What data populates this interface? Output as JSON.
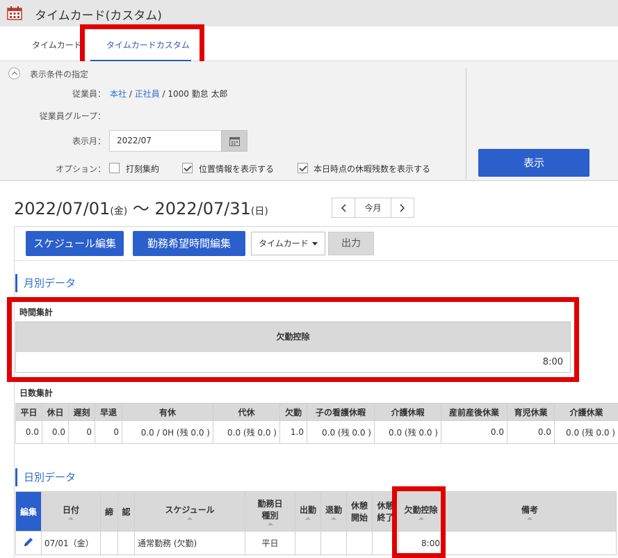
{
  "window": {
    "title": "タイムカード(カスタム)",
    "icon": "calendar-icon"
  },
  "tabs": [
    {
      "label": "タイムカード",
      "active": false
    },
    {
      "label": "タイムカードカスタム",
      "active": true
    }
  ],
  "conditions": {
    "title": "表示条件の指定",
    "employee_label": "従業員：",
    "employee": {
      "company": "本社",
      "sep1": " / ",
      "type": "正社員",
      "rest": " / 1000 勤怠 太郎"
    },
    "group_label": "従業員グループ：",
    "month_label": "表示月：",
    "month_value": "2022/07",
    "options_label": "オプション：",
    "options": [
      {
        "label": "打刻集約",
        "checked": false
      },
      {
        "label": "位置情報を表示する",
        "checked": true
      },
      {
        "label": "本日時点の休暇残数を表示する",
        "checked": true
      }
    ],
    "show_button": "表示"
  },
  "range": {
    "start": "2022/07/01",
    "start_day": "(金)",
    "sep": " 〜 ",
    "end": "2022/07/31",
    "end_day": "(日)"
  },
  "nav": {
    "today": "今月"
  },
  "toolbar": {
    "schedule_edit": "スケジュール編集",
    "wish_edit": "勤務希望時間編集",
    "select_value": "タイムカード",
    "output": "出力"
  },
  "monthly": {
    "section_title": "月別データ",
    "time_summary_title": "時間集計",
    "time_header": "欠勤控除",
    "time_value": "8:00",
    "days_summary_title": "日数集計",
    "days_headers": [
      "平日",
      "休日",
      "遅刻",
      "早退",
      "有休",
      "代休",
      "欠勤",
      "子の看護休暇",
      "介護休暇",
      "産前産後休業",
      "育児休業",
      "介護休業"
    ],
    "days_values": [
      "0.0",
      "0.0",
      "0",
      "0",
      "0.0 / 0H (残 0.0 )",
      "0.0 (残 0.0 )",
      "1.0",
      "0.0 (残 0.0 )",
      "0.0 (残 0.0 )",
      "0.0",
      "0.0",
      "0.0 (残 0.0 )"
    ]
  },
  "daily": {
    "section_title": "日別データ",
    "headers": {
      "edit": "編集",
      "date": "日付",
      "close": "締",
      "approve": "認",
      "schedule": "スケジュール",
      "daytype1": "勤務日",
      "daytype2": "種別",
      "in": "出勤",
      "out": "退勤",
      "break_start1": "休憩",
      "break_start2": "開始",
      "break_end1": "休憩",
      "break_end2": "終了",
      "absence": "欠勤控除",
      "note": "備考"
    },
    "rows": [
      {
        "date": "07/01（金）",
        "schedule": "通常勤務 (欠勤)",
        "daytype": "平日",
        "absence": "8:00",
        "note": ""
      }
    ]
  },
  "colors": {
    "accent": "#2b5fcb",
    "highlight": "#e00000"
  }
}
